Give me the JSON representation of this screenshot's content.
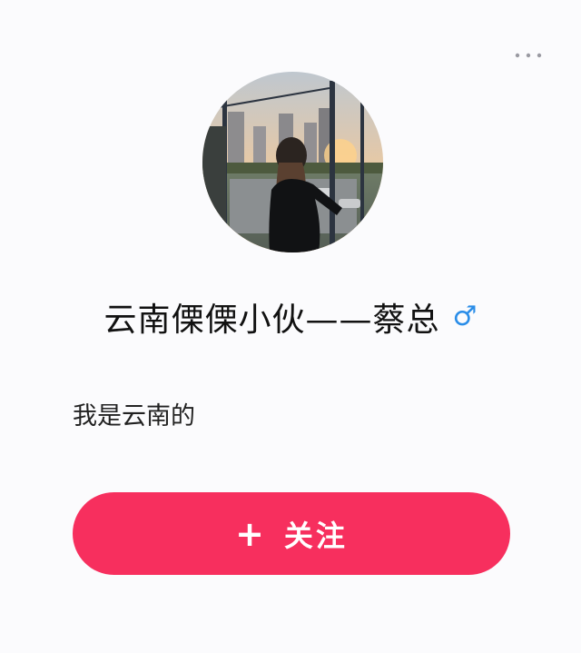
{
  "header": {
    "more_icon": "more-horizontal-icon"
  },
  "profile": {
    "avatar_icon": "avatar-photo",
    "nickname": "云南傈傈小伙——蔡总",
    "gender_symbol": "♂",
    "gender_icon": "male-gender-icon",
    "bio": "我是云南的"
  },
  "actions": {
    "follow_plus": "+",
    "follow_label": "关注"
  },
  "colors": {
    "accent": "#f72f5e",
    "gender_blue": "#2a8de8",
    "background": "#fbfbfd"
  }
}
